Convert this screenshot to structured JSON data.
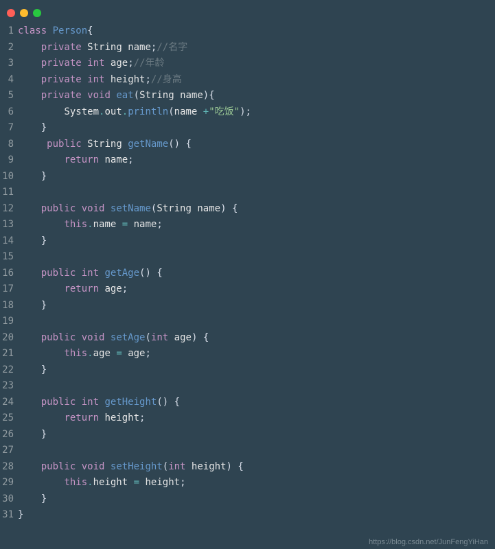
{
  "window": {
    "buttons": [
      "close",
      "minimize",
      "zoom"
    ]
  },
  "lines": [
    {
      "n": "1",
      "tokens": [
        [
          "kw",
          "class"
        ],
        [
          "sp",
          " "
        ],
        [
          "cls",
          "Person"
        ],
        [
          "punc",
          "{"
        ]
      ]
    },
    {
      "n": "2",
      "tokens": [
        [
          "sp",
          "    "
        ],
        [
          "kw",
          "private"
        ],
        [
          "sp",
          " "
        ],
        [
          "id",
          "String"
        ],
        [
          "sp",
          " "
        ],
        [
          "id",
          "name"
        ],
        [
          "punc",
          ";"
        ],
        [
          "cmt",
          "//名字"
        ]
      ]
    },
    {
      "n": "3",
      "tokens": [
        [
          "sp",
          "    "
        ],
        [
          "kw",
          "private"
        ],
        [
          "sp",
          " "
        ],
        [
          "type",
          "int"
        ],
        [
          "sp",
          " "
        ],
        [
          "id",
          "age"
        ],
        [
          "punc",
          ";"
        ],
        [
          "cmt",
          "//年龄"
        ]
      ]
    },
    {
      "n": "4",
      "tokens": [
        [
          "sp",
          "    "
        ],
        [
          "kw",
          "private"
        ],
        [
          "sp",
          " "
        ],
        [
          "type",
          "int"
        ],
        [
          "sp",
          " "
        ],
        [
          "id",
          "height"
        ],
        [
          "punc",
          ";"
        ],
        [
          "cmt",
          "//身高"
        ]
      ]
    },
    {
      "n": "5",
      "tokens": [
        [
          "sp",
          "    "
        ],
        [
          "kw",
          "private"
        ],
        [
          "sp",
          " "
        ],
        [
          "type",
          "void"
        ],
        [
          "sp",
          " "
        ],
        [
          "fn",
          "eat"
        ],
        [
          "paren",
          "("
        ],
        [
          "id",
          "String"
        ],
        [
          "sp",
          " "
        ],
        [
          "id",
          "name"
        ],
        [
          "paren",
          ")"
        ],
        [
          "punc",
          "{"
        ]
      ]
    },
    {
      "n": "6",
      "tokens": [
        [
          "sp",
          "        "
        ],
        [
          "id",
          "System"
        ],
        [
          "dot2",
          "."
        ],
        [
          "id",
          "out"
        ],
        [
          "dot2",
          "."
        ],
        [
          "fn",
          "println"
        ],
        [
          "paren",
          "("
        ],
        [
          "id",
          "name"
        ],
        [
          "sp",
          " "
        ],
        [
          "dot2",
          "+"
        ],
        [
          "str",
          "\"吃饭\""
        ],
        [
          "paren",
          ")"
        ],
        [
          "punc",
          ";"
        ]
      ]
    },
    {
      "n": "7",
      "tokens": [
        [
          "sp",
          "    "
        ],
        [
          "punc",
          "}"
        ]
      ]
    },
    {
      "n": "8",
      "tokens": [
        [
          "sp",
          "     "
        ],
        [
          "kw",
          "public"
        ],
        [
          "sp",
          " "
        ],
        [
          "id",
          "String"
        ],
        [
          "sp",
          " "
        ],
        [
          "fn",
          "getName"
        ],
        [
          "paren",
          "()"
        ],
        [
          "sp",
          " "
        ],
        [
          "punc",
          "{"
        ]
      ]
    },
    {
      "n": "9",
      "tokens": [
        [
          "sp",
          "        "
        ],
        [
          "kw",
          "return"
        ],
        [
          "sp",
          " "
        ],
        [
          "id",
          "name"
        ],
        [
          "punc",
          ";"
        ]
      ]
    },
    {
      "n": "10",
      "tokens": [
        [
          "sp",
          "    "
        ],
        [
          "punc",
          "}"
        ]
      ]
    },
    {
      "n": "11",
      "tokens": []
    },
    {
      "n": "12",
      "tokens": [
        [
          "sp",
          "    "
        ],
        [
          "kw",
          "public"
        ],
        [
          "sp",
          " "
        ],
        [
          "type",
          "void"
        ],
        [
          "sp",
          " "
        ],
        [
          "fn",
          "setName"
        ],
        [
          "paren",
          "("
        ],
        [
          "id",
          "String"
        ],
        [
          "sp",
          " "
        ],
        [
          "id",
          "name"
        ],
        [
          "paren",
          ")"
        ],
        [
          "sp",
          " "
        ],
        [
          "punc",
          "{"
        ]
      ]
    },
    {
      "n": "13",
      "tokens": [
        [
          "sp",
          "        "
        ],
        [
          "kw",
          "this"
        ],
        [
          "dot2",
          "."
        ],
        [
          "id",
          "name"
        ],
        [
          "sp",
          " "
        ],
        [
          "dot2",
          "="
        ],
        [
          "sp",
          " "
        ],
        [
          "id",
          "name"
        ],
        [
          "punc",
          ";"
        ]
      ]
    },
    {
      "n": "14",
      "tokens": [
        [
          "sp",
          "    "
        ],
        [
          "punc",
          "}"
        ]
      ]
    },
    {
      "n": "15",
      "tokens": []
    },
    {
      "n": "16",
      "tokens": [
        [
          "sp",
          "    "
        ],
        [
          "kw",
          "public"
        ],
        [
          "sp",
          " "
        ],
        [
          "type",
          "int"
        ],
        [
          "sp",
          " "
        ],
        [
          "fn",
          "getAge"
        ],
        [
          "paren",
          "()"
        ],
        [
          "sp",
          " "
        ],
        [
          "punc",
          "{"
        ]
      ]
    },
    {
      "n": "17",
      "tokens": [
        [
          "sp",
          "        "
        ],
        [
          "kw",
          "return"
        ],
        [
          "sp",
          " "
        ],
        [
          "id",
          "age"
        ],
        [
          "punc",
          ";"
        ]
      ]
    },
    {
      "n": "18",
      "tokens": [
        [
          "sp",
          "    "
        ],
        [
          "punc",
          "}"
        ]
      ]
    },
    {
      "n": "19",
      "tokens": []
    },
    {
      "n": "20",
      "tokens": [
        [
          "sp",
          "    "
        ],
        [
          "kw",
          "public"
        ],
        [
          "sp",
          " "
        ],
        [
          "type",
          "void"
        ],
        [
          "sp",
          " "
        ],
        [
          "fn",
          "setAge"
        ],
        [
          "paren",
          "("
        ],
        [
          "type",
          "int"
        ],
        [
          "sp",
          " "
        ],
        [
          "id",
          "age"
        ],
        [
          "paren",
          ")"
        ],
        [
          "sp",
          " "
        ],
        [
          "punc",
          "{"
        ]
      ]
    },
    {
      "n": "21",
      "tokens": [
        [
          "sp",
          "        "
        ],
        [
          "kw",
          "this"
        ],
        [
          "dot2",
          "."
        ],
        [
          "id",
          "age"
        ],
        [
          "sp",
          " "
        ],
        [
          "dot2",
          "="
        ],
        [
          "sp",
          " "
        ],
        [
          "id",
          "age"
        ],
        [
          "punc",
          ";"
        ]
      ]
    },
    {
      "n": "22",
      "tokens": [
        [
          "sp",
          "    "
        ],
        [
          "punc",
          "}"
        ]
      ]
    },
    {
      "n": "23",
      "tokens": []
    },
    {
      "n": "24",
      "tokens": [
        [
          "sp",
          "    "
        ],
        [
          "kw",
          "public"
        ],
        [
          "sp",
          " "
        ],
        [
          "type",
          "int"
        ],
        [
          "sp",
          " "
        ],
        [
          "fn",
          "getHeight"
        ],
        [
          "paren",
          "()"
        ],
        [
          "sp",
          " "
        ],
        [
          "punc",
          "{"
        ]
      ]
    },
    {
      "n": "25",
      "tokens": [
        [
          "sp",
          "        "
        ],
        [
          "kw",
          "return"
        ],
        [
          "sp",
          " "
        ],
        [
          "id",
          "height"
        ],
        [
          "punc",
          ";"
        ]
      ]
    },
    {
      "n": "26",
      "tokens": [
        [
          "sp",
          "    "
        ],
        [
          "punc",
          "}"
        ]
      ]
    },
    {
      "n": "27",
      "tokens": []
    },
    {
      "n": "28",
      "tokens": [
        [
          "sp",
          "    "
        ],
        [
          "kw",
          "public"
        ],
        [
          "sp",
          " "
        ],
        [
          "type",
          "void"
        ],
        [
          "sp",
          " "
        ],
        [
          "fn",
          "setHeight"
        ],
        [
          "paren",
          "("
        ],
        [
          "type",
          "int"
        ],
        [
          "sp",
          " "
        ],
        [
          "id",
          "height"
        ],
        [
          "paren",
          ")"
        ],
        [
          "sp",
          " "
        ],
        [
          "punc",
          "{"
        ]
      ]
    },
    {
      "n": "29",
      "tokens": [
        [
          "sp",
          "        "
        ],
        [
          "kw",
          "this"
        ],
        [
          "dot2",
          "."
        ],
        [
          "id",
          "height"
        ],
        [
          "sp",
          " "
        ],
        [
          "dot2",
          "="
        ],
        [
          "sp",
          " "
        ],
        [
          "id",
          "height"
        ],
        [
          "punc",
          ";"
        ]
      ]
    },
    {
      "n": "30",
      "tokens": [
        [
          "sp",
          "    "
        ],
        [
          "punc",
          "}"
        ]
      ]
    },
    {
      "n": "31",
      "tokens": [
        [
          "punc",
          "}"
        ]
      ]
    }
  ],
  "watermark": "https://blog.csdn.net/JunFengYiHan"
}
